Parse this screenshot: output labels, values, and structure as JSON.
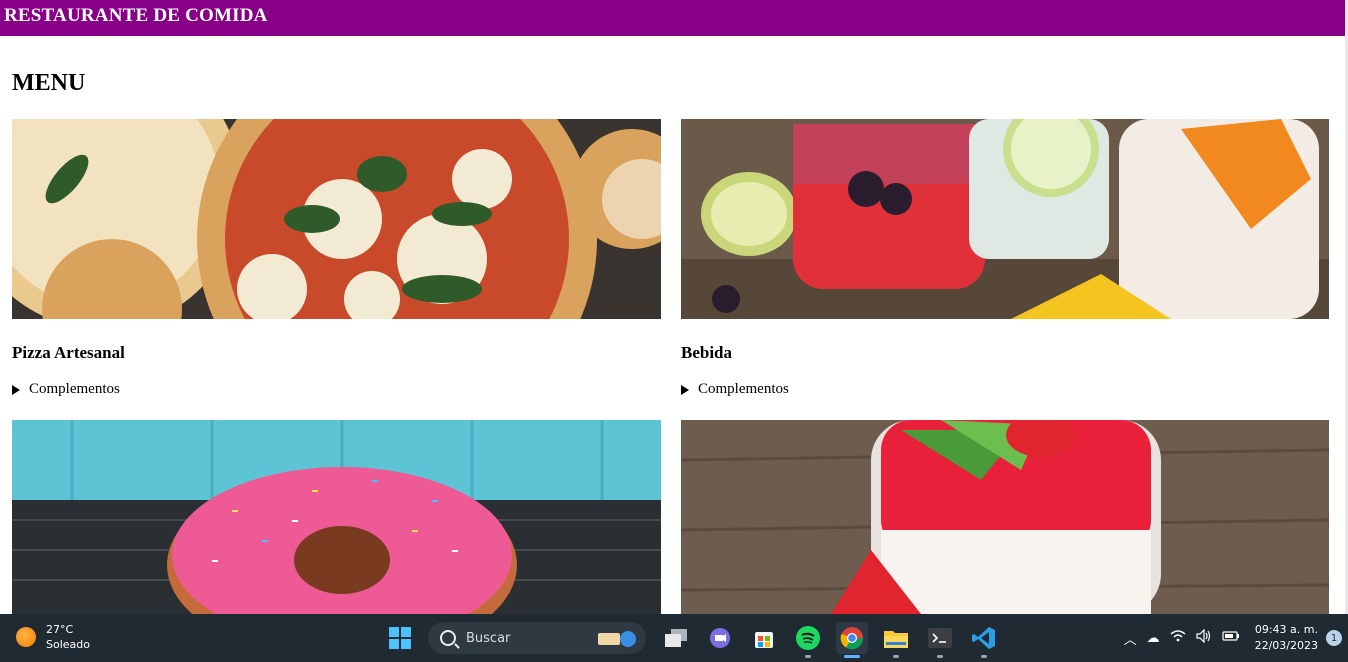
{
  "header": {
    "title": "RESTAURANTE DE COMIDA"
  },
  "menu": {
    "title": "MENU",
    "items": [
      {
        "name": "Pizza Artesanal",
        "details_label": "Complementos",
        "image": "pizza"
      },
      {
        "name": "Bebida",
        "details_label": "Complementos",
        "image": "drinks"
      },
      {
        "name": "",
        "details_label": "",
        "image": "donut"
      },
      {
        "name": "",
        "details_label": "",
        "image": "strawberry-dessert"
      }
    ]
  },
  "taskbar": {
    "weather": {
      "temp": "27°C",
      "condition": "Soleado"
    },
    "search_label": "Buscar",
    "apps": [
      "windows-start-icon",
      "task-view-icon",
      "meet-icon",
      "store-icon",
      "spotify-icon",
      "chrome-icon",
      "file-explorer-icon",
      "terminal-icon",
      "vscode-icon"
    ],
    "clock": {
      "time": "09:43 a. m.",
      "date": "22/03/2023"
    },
    "notification_count": "1"
  },
  "colors": {
    "header_bg": "#880088",
    "taskbar_bg": "#1f2a33"
  }
}
